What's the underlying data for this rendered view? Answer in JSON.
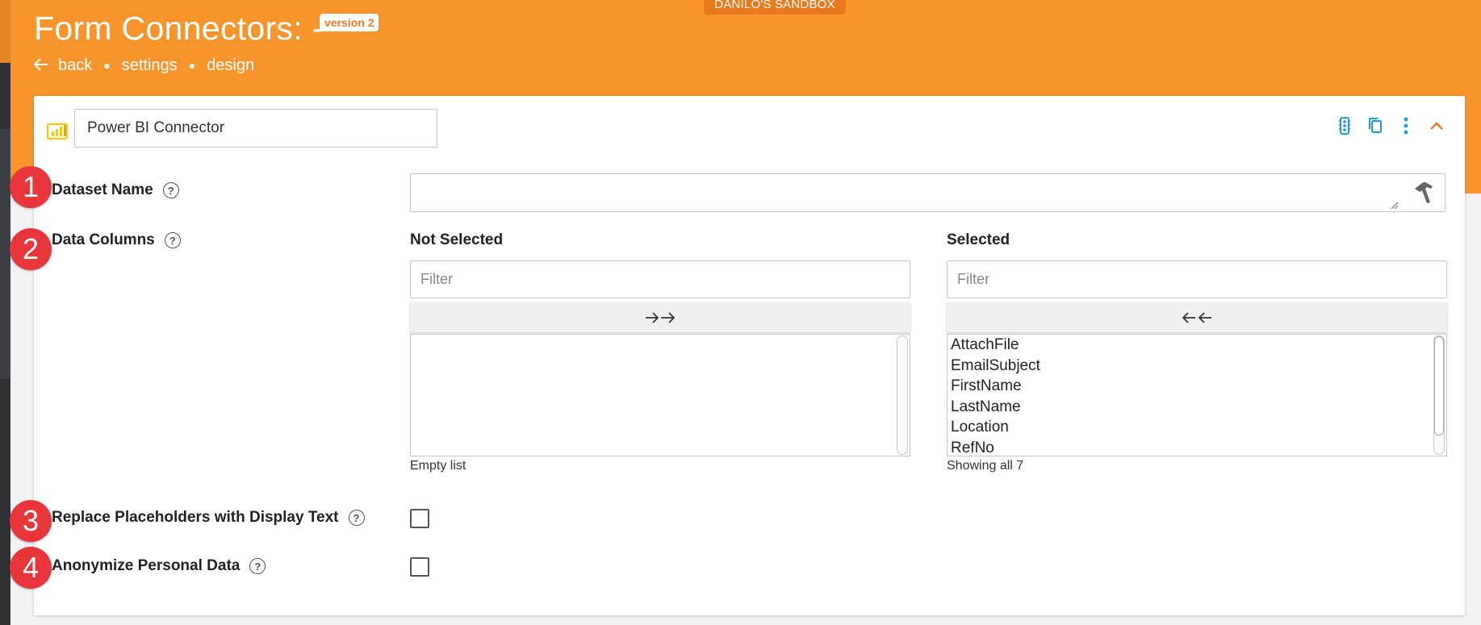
{
  "environment_badge": "DANILO'S SANDBOX",
  "header": {
    "title": "Form Connectors: -",
    "version_badge": "version 2",
    "breadcrumb": {
      "back": "back",
      "settings": "settings",
      "design": "design"
    }
  },
  "connector": {
    "icon": "power-bi-icon",
    "name": "Power BI Connector",
    "tool_icons": [
      "traffic-light-icon",
      "copy-icon",
      "more-vertical-icon",
      "chevron-up-icon"
    ]
  },
  "fields": {
    "dataset_name": {
      "label": "Dataset Name",
      "value": ""
    },
    "data_columns": {
      "label": "Data Columns",
      "not_selected": {
        "heading": "Not Selected",
        "filter_placeholder": "Filter",
        "items": [],
        "footer": "Empty list"
      },
      "selected": {
        "heading": "Selected",
        "filter_placeholder": "Filter",
        "items": [
          "AttachFile",
          "EmailSubject",
          "FirstName",
          "LastName",
          "Location",
          "RefNo"
        ],
        "footer": "Showing all 7"
      }
    },
    "replace_placeholders": {
      "label": "Replace Placeholders with Display Text",
      "checked": false
    },
    "anonymize": {
      "label": "Anonymize Personal Data",
      "checked": false
    }
  },
  "steps": [
    "1",
    "2",
    "3",
    "4"
  ],
  "colors": {
    "header": "#f7952c",
    "accent": "#f47a20",
    "step": "#e8363b",
    "tool_blue": "#1e9ad6"
  }
}
